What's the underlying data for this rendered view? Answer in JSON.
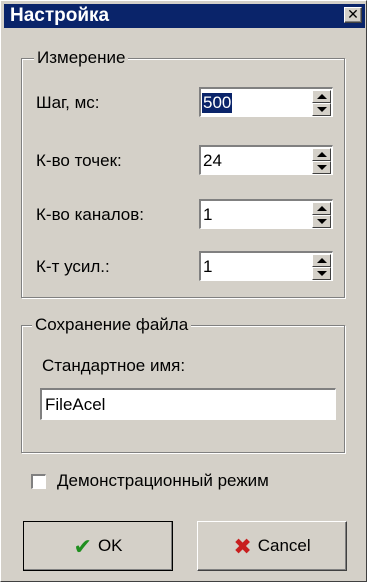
{
  "window": {
    "title": "Настройка",
    "close_glyph": "✕"
  },
  "measurement": {
    "legend": "Измерение",
    "fields": [
      {
        "label": "Шаг, мс:",
        "value": "500"
      },
      {
        "label": "К-во точек:",
        "value": "24"
      },
      {
        "label": "К-во каналов:",
        "value": "1"
      },
      {
        "label": "К-т усил.:",
        "value": "1"
      }
    ]
  },
  "file_save": {
    "legend": "Сохранение файла",
    "default_name_label": "Стандартное имя:",
    "default_name_value": "FileAcel"
  },
  "demo_mode": {
    "label": "Демонстрационный режим",
    "checked": false
  },
  "buttons": {
    "ok": {
      "label": "OK",
      "icon": "check-icon"
    },
    "cancel": {
      "label": "Cancel",
      "icon": "cross-icon"
    }
  },
  "colors": {
    "titlebar": "#0a246a",
    "face": "#d4d0c8",
    "ok_icon": "#1f8f1f",
    "cancel_icon": "#c81e1e"
  }
}
